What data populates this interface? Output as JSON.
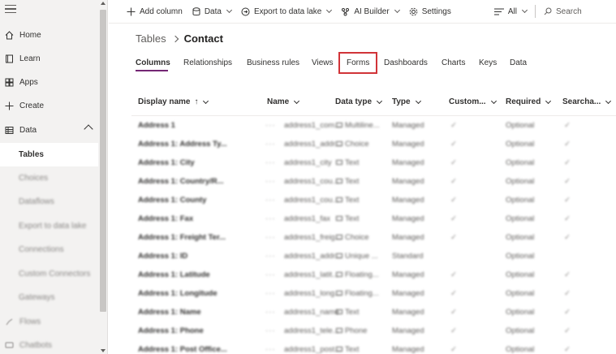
{
  "sidebar": {
    "items": [
      {
        "label": "Home",
        "icon": "home-icon"
      },
      {
        "label": "Learn",
        "icon": "book-icon"
      },
      {
        "label": "Apps",
        "icon": "apps-icon"
      },
      {
        "label": "Create",
        "icon": "plus-icon"
      },
      {
        "label": "Data",
        "icon": "table-icon"
      }
    ],
    "data_children": [
      {
        "label": "Tables"
      },
      {
        "label": "Choices"
      },
      {
        "label": "Dataflows"
      },
      {
        "label": "Export to data lake"
      },
      {
        "label": "Connections"
      },
      {
        "label": "Custom Connectors"
      },
      {
        "label": "Gateways"
      }
    ],
    "bottom_items": [
      {
        "label": "Flows"
      },
      {
        "label": "Chatbots"
      }
    ]
  },
  "commandbar": {
    "add_column": "Add column",
    "data": "Data",
    "export": "Export to data lake",
    "ai_builder": "AI Builder",
    "settings": "Settings",
    "view": "All",
    "search_placeholder": "Search"
  },
  "breadcrumb": {
    "parent": "Tables",
    "current": "Contact"
  },
  "tabs": [
    {
      "label": "Columns"
    },
    {
      "label": "Relationships"
    },
    {
      "label": "Business rules"
    },
    {
      "label": "Views"
    },
    {
      "label": "Forms"
    },
    {
      "label": "Dashboards"
    },
    {
      "label": "Charts"
    },
    {
      "label": "Keys"
    },
    {
      "label": "Data"
    }
  ],
  "table": {
    "headers": {
      "display_name": "Display name",
      "sort_indicator": "↑",
      "name": "Name",
      "data_type": "Data type",
      "type": "Type",
      "custom": "Custom...",
      "required": "Required",
      "searchable": "Searcha..."
    },
    "rows": [
      {
        "display_name": "Address 1",
        "name": "address1_com...",
        "data_type": "Multiline...",
        "type": "Managed",
        "custom": "✓",
        "required": "Optional",
        "searchable": "✓"
      },
      {
        "display_name": "Address 1: Address Ty...",
        "name": "address1_addr...",
        "data_type": "Choice",
        "type": "Managed",
        "custom": "✓",
        "required": "Optional",
        "searchable": "✓"
      },
      {
        "display_name": "Address 1: City",
        "name": "address1_city",
        "data_type": "Text",
        "type": "Managed",
        "custom": "✓",
        "required": "Optional",
        "searchable": "✓"
      },
      {
        "display_name": "Address 1: Country/R...",
        "name": "address1_cou...",
        "data_type": "Text",
        "type": "Managed",
        "custom": "✓",
        "required": "Optional",
        "searchable": "✓"
      },
      {
        "display_name": "Address 1: County",
        "name": "address1_cou...",
        "data_type": "Text",
        "type": "Managed",
        "custom": "✓",
        "required": "Optional",
        "searchable": "✓"
      },
      {
        "display_name": "Address 1: Fax",
        "name": "address1_fax",
        "data_type": "Text",
        "type": "Managed",
        "custom": "✓",
        "required": "Optional",
        "searchable": "✓"
      },
      {
        "display_name": "Address 1: Freight Ter...",
        "name": "address1_freig...",
        "data_type": "Choice",
        "type": "Managed",
        "custom": "✓",
        "required": "Optional",
        "searchable": "✓"
      },
      {
        "display_name": "Address 1: ID",
        "name": "address1_addr...",
        "data_type": "Unique ...",
        "type": "Standard",
        "custom": "",
        "required": "Optional",
        "searchable": ""
      },
      {
        "display_name": "Address 1: Latitude",
        "name": "address1_latit...",
        "data_type": "Floating...",
        "type": "Managed",
        "custom": "✓",
        "required": "Optional",
        "searchable": "✓"
      },
      {
        "display_name": "Address 1: Longitude",
        "name": "address1_long...",
        "data_type": "Floating...",
        "type": "Managed",
        "custom": "✓",
        "required": "Optional",
        "searchable": "✓"
      },
      {
        "display_name": "Address 1: Name",
        "name": "address1_name",
        "data_type": "Text",
        "type": "Managed",
        "custom": "✓",
        "required": "Optional",
        "searchable": "✓"
      },
      {
        "display_name": "Address 1: Phone",
        "name": "address1_tele...",
        "data_type": "Phone",
        "type": "Managed",
        "custom": "✓",
        "required": "Optional",
        "searchable": "✓"
      },
      {
        "display_name": "Address 1: Post Office...",
        "name": "address1_post...",
        "data_type": "Text",
        "type": "Managed",
        "custom": "✓",
        "required": "Optional",
        "searchable": "✓"
      }
    ]
  },
  "colors": {
    "accent": "#742774",
    "highlight": "#d13438"
  }
}
